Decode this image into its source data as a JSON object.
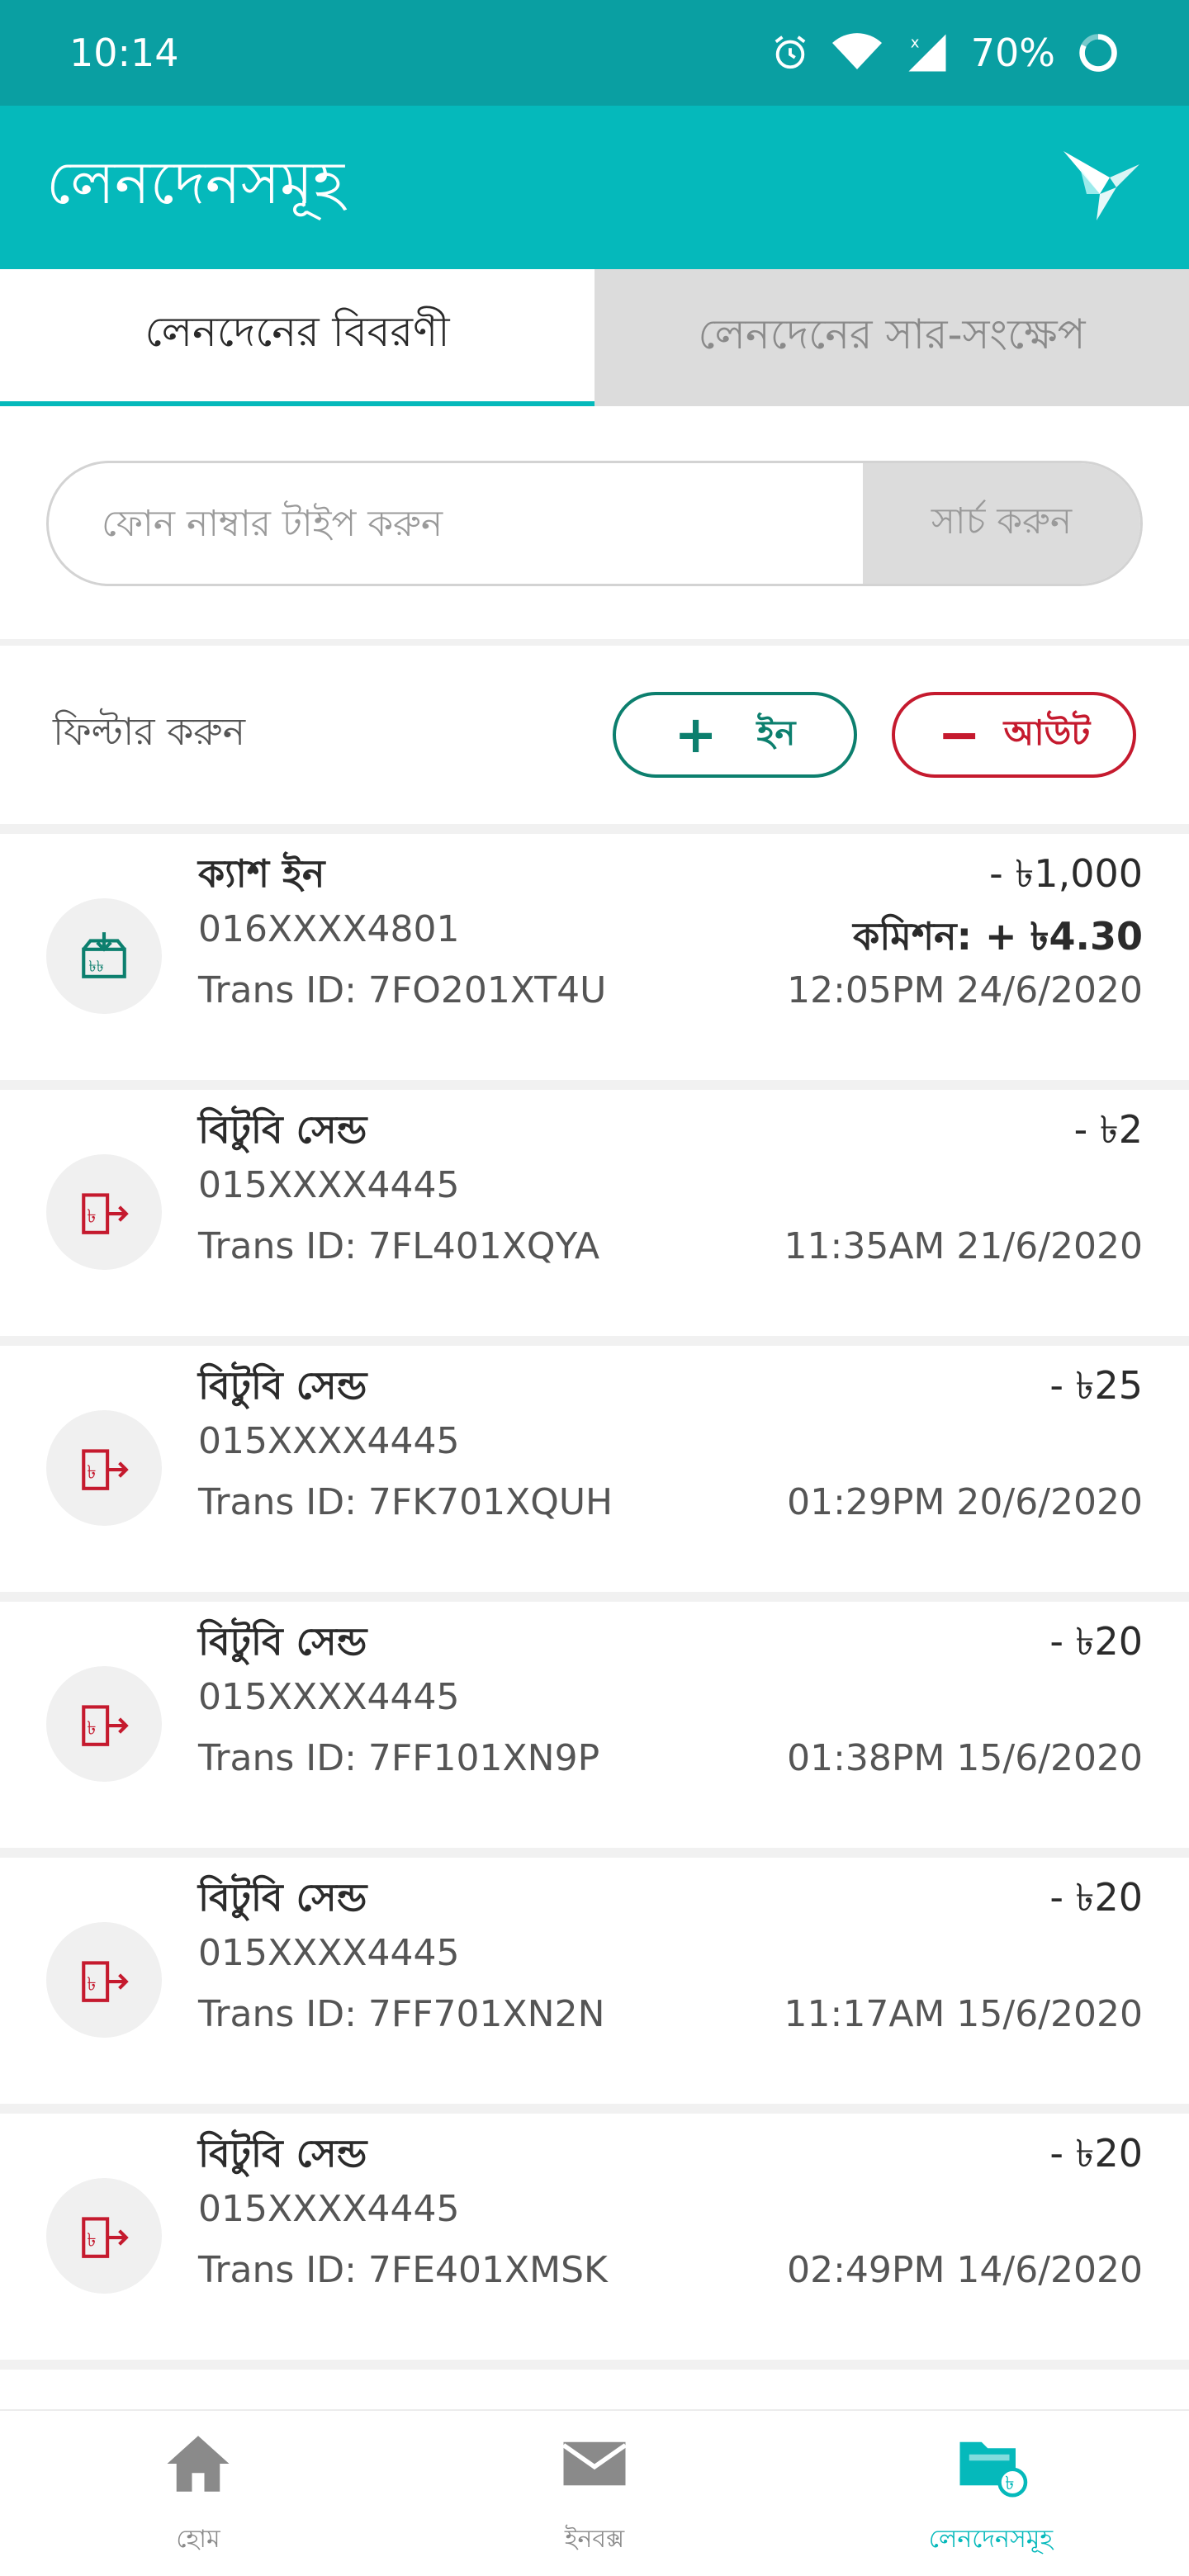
{
  "status_bar": {
    "time": "10:14",
    "battery": "70%"
  },
  "app_bar": {
    "title": "লেনদেনসমূহ"
  },
  "tabs": [
    {
      "label": "লেনদেনের বিবরণী",
      "active": true
    },
    {
      "label": "লেনদেনের সার-সংক্ষেপ",
      "active": false
    }
  ],
  "search": {
    "placeholder": "ফোন নাম্বার টাইপ করুন",
    "button_label": "সার্চ করুন"
  },
  "filter": {
    "label": "ফিল্টার করুন",
    "in_label": "ইন",
    "out_label": "আউট"
  },
  "transactions": [
    {
      "type": "ক্যাশ ইন",
      "icon": "cash-in-icon",
      "phone": "016XXXX4801",
      "trans_id": "Trans ID: 7FO201XT4U",
      "amount": "- ৳1,000",
      "commission": "কমিশন:  + ৳4.30",
      "datetime": "12:05PM 24/6/2020"
    },
    {
      "type": "বিটুবি সেন্ড",
      "icon": "b2b-send-icon",
      "phone": "015XXXX4445",
      "trans_id": "Trans ID: 7FL401XQYA",
      "amount": "- ৳2",
      "datetime": "11:35AM 21/6/2020"
    },
    {
      "type": "বিটুবি সেন্ড",
      "icon": "b2b-send-icon",
      "phone": "015XXXX4445",
      "trans_id": "Trans ID: 7FK701XQUH",
      "amount": "- ৳25",
      "datetime": "01:29PM 20/6/2020"
    },
    {
      "type": "বিটুবি সেন্ড",
      "icon": "b2b-send-icon",
      "phone": "015XXXX4445",
      "trans_id": "Trans ID: 7FF101XN9P",
      "amount": "- ৳20",
      "datetime": "01:38PM 15/6/2020"
    },
    {
      "type": "বিটুবি সেন্ড",
      "icon": "b2b-send-icon",
      "phone": "015XXXX4445",
      "trans_id": "Trans ID: 7FF701XN2N",
      "amount": "- ৳20",
      "datetime": "11:17AM 15/6/2020"
    },
    {
      "type": "বিটুবি সেন্ড",
      "icon": "b2b-send-icon",
      "phone": "015XXXX4445",
      "trans_id": "Trans ID: 7FE401XMSK",
      "amount": "- ৳20",
      "datetime": "02:49PM 14/6/2020"
    }
  ],
  "bottom_nav": [
    {
      "label": "হোম",
      "icon": "home-icon",
      "active": false
    },
    {
      "label": "ইনবক্স",
      "icon": "mail-icon",
      "active": false
    },
    {
      "label": "লেনদেনসমূহ",
      "icon": "transactions-folder-icon",
      "active": true
    }
  ],
  "colors": {
    "status_bar": "#0a9fa2",
    "app_bar": "#05b9bb",
    "in_green": "#0c7f6e",
    "out_red": "#c51a2e",
    "tab_inactive": "#dcdcdc"
  }
}
